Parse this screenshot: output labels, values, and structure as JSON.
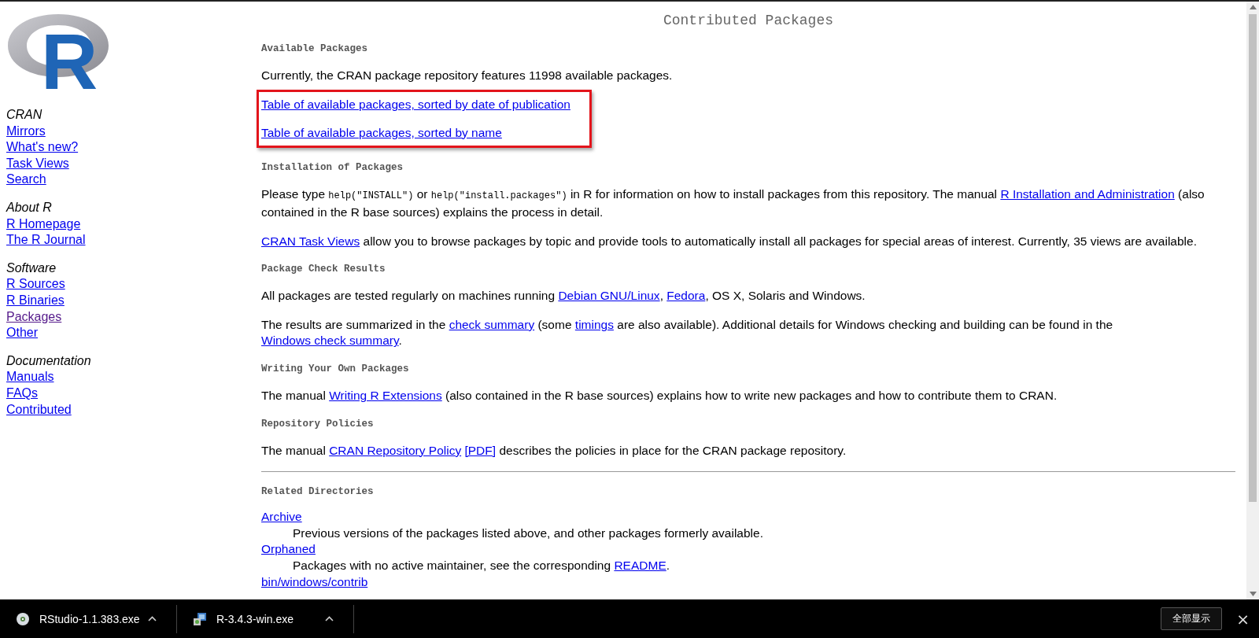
{
  "logo": {
    "text": "R"
  },
  "sidebar": {
    "groups": [
      {
        "title": "CRAN",
        "links": [
          {
            "label": "Mirrors",
            "visited": false
          },
          {
            "label": "What's new?",
            "visited": false
          },
          {
            "label": "Task Views",
            "visited": false
          },
          {
            "label": "Search",
            "visited": false
          }
        ]
      },
      {
        "title": "About R",
        "links": [
          {
            "label": "R Homepage",
            "visited": false
          },
          {
            "label": "The R Journal",
            "visited": false
          }
        ]
      },
      {
        "title": "Software",
        "links": [
          {
            "label": "R Sources",
            "visited": false
          },
          {
            "label": "R Binaries",
            "visited": false
          },
          {
            "label": "Packages",
            "visited": true
          },
          {
            "label": "Other",
            "visited": false
          }
        ]
      },
      {
        "title": "Documentation",
        "links": [
          {
            "label": "Manuals",
            "visited": false
          },
          {
            "label": "FAQs",
            "visited": false
          },
          {
            "label": "Contributed",
            "visited": false
          }
        ]
      }
    ]
  },
  "title": "Contributed Packages",
  "sections": [
    {
      "heading": "Available Packages",
      "blocks": [
        {
          "kind": "paragraph",
          "segments": [
            {
              "kind": "text",
              "text": "Currently, the CRAN package repository features 11998 available packages."
            }
          ]
        },
        {
          "kind": "highlight",
          "links": [
            "Table of available packages, sorted by date of publication",
            "Table of available packages, sorted by name"
          ]
        }
      ]
    },
    {
      "heading": "Installation of Packages",
      "blocks": [
        {
          "kind": "paragraph",
          "segments": [
            {
              "kind": "text",
              "text": "Please type "
            },
            {
              "kind": "code",
              "text": "help(\"INSTALL\")"
            },
            {
              "kind": "text",
              "text": " or "
            },
            {
              "kind": "code",
              "text": "help(\"install.packages\")"
            },
            {
              "kind": "text",
              "text": " in R for information on how to install packages from this repository. The manual "
            },
            {
              "kind": "link",
              "text": "R Installation and Administration"
            },
            {
              "kind": "text",
              "text": " (also contained in the R base sources) explains the process in detail."
            }
          ]
        },
        {
          "kind": "paragraph",
          "segments": [
            {
              "kind": "link",
              "text": "CRAN Task Views"
            },
            {
              "kind": "text",
              "text": " allow you to browse packages by topic and provide tools to automatically install all packages for special areas of interest. Currently, 35 views are available."
            }
          ]
        }
      ]
    },
    {
      "heading": "Package Check Results",
      "blocks": [
        {
          "kind": "paragraph",
          "segments": [
            {
              "kind": "text",
              "text": "All packages are tested regularly on machines running "
            },
            {
              "kind": "link",
              "text": "Debian GNU/Linux"
            },
            {
              "kind": "text",
              "text": ", "
            },
            {
              "kind": "link",
              "text": "Fedora"
            },
            {
              "kind": "text",
              "text": ", OS X, Solaris and Windows."
            }
          ]
        },
        {
          "kind": "paragraph",
          "segments": [
            {
              "kind": "text",
              "text": "The results are summarized in the "
            },
            {
              "kind": "link",
              "text": "check summary"
            },
            {
              "kind": "text",
              "text": " (some "
            },
            {
              "kind": "link",
              "text": "timings"
            },
            {
              "kind": "text",
              "text": " are also available). Additional details for Windows checking and building can be found in the "
            },
            {
              "kind": "link",
              "text": "Windows check summary"
            },
            {
              "kind": "text",
              "text": "."
            }
          ]
        }
      ]
    },
    {
      "heading": "Writing Your Own Packages",
      "blocks": [
        {
          "kind": "paragraph",
          "segments": [
            {
              "kind": "text",
              "text": "The manual "
            },
            {
              "kind": "link",
              "text": "Writing R Extensions"
            },
            {
              "kind": "text",
              "text": " (also contained in the R base sources) explains how to write new packages and how to contribute them to CRAN."
            }
          ]
        }
      ]
    },
    {
      "heading": "Repository Policies",
      "blocks": [
        {
          "kind": "paragraph",
          "segments": [
            {
              "kind": "text",
              "text": "The manual "
            },
            {
              "kind": "link",
              "text": "CRAN Repository Policy"
            },
            {
              "kind": "link",
              "text": "[PDF]",
              "gap_before": true
            },
            {
              "kind": "text",
              "text": " describes the policies in place for the CRAN package repository."
            }
          ]
        },
        {
          "kind": "rule"
        }
      ]
    },
    {
      "heading": "Related Directories",
      "blocks": [
        {
          "kind": "dirlist",
          "items": [
            {
              "link": "Archive",
              "description": [
                {
                  "kind": "text",
                  "text": "Previous versions of the packages listed above, and other packages formerly available."
                }
              ]
            },
            {
              "link": "Orphaned",
              "description": [
                {
                  "kind": "text",
                  "text": "Packages with no active maintainer, see the corresponding "
                },
                {
                  "kind": "link",
                  "text": "README"
                },
                {
                  "kind": "text",
                  "text": "."
                }
              ]
            },
            {
              "link": "bin/windows/contrib"
            }
          ]
        }
      ]
    }
  ],
  "downloads": {
    "items": [
      {
        "name": "RStudio-1.1.383.exe",
        "kind": "disc"
      },
      {
        "name": "R-3.4.3-win.exe",
        "kind": "installer"
      }
    ],
    "show_all": "全部显示",
    "close": "×"
  }
}
